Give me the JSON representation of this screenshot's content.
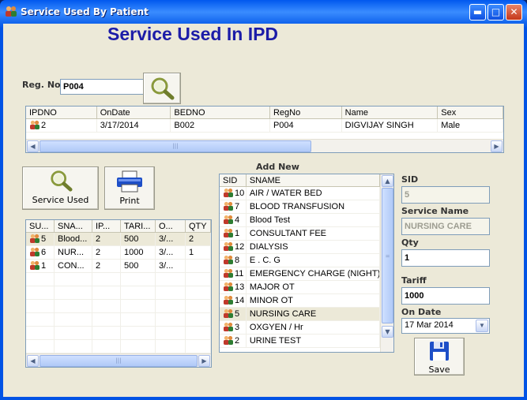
{
  "window": {
    "title": "Service Used By Patient"
  },
  "heading": "Service Used In IPD",
  "reg": {
    "label": "Reg. No.",
    "value": "P004"
  },
  "ipd_grid": {
    "columns": [
      "IPDNO",
      "OnDate",
      "BEDNO",
      "RegNo",
      "Name",
      "Sex"
    ],
    "rows": [
      [
        "2",
        "3/17/2014",
        "B002",
        "P004",
        "DIGVIJAY SINGH",
        "Male"
      ]
    ]
  },
  "buttons": {
    "service_used": "Service Used",
    "print": "Print",
    "save": "Save"
  },
  "used_grid": {
    "columns": [
      "SU...",
      "SNA...",
      "IP...",
      "TARI...",
      "O...",
      "QTY"
    ],
    "rows": [
      [
        "5",
        "Blood...",
        "2",
        "500",
        "3/...",
        "2"
      ],
      [
        "6",
        "NUR...",
        "2",
        "1000",
        "3/...",
        "1"
      ],
      [
        "1",
        "CON...",
        "2",
        "500",
        "3/...",
        ""
      ]
    ]
  },
  "add_new": {
    "title": "Add New",
    "columns": [
      "SID",
      "SNAME"
    ],
    "rows": [
      [
        "10",
        "AIR / WATER BED"
      ],
      [
        "7",
        "BLOOD TRANSFUSION"
      ],
      [
        "4",
        "Blood Test"
      ],
      [
        "1",
        "CONSULTANT FEE"
      ],
      [
        "12",
        "DIALYSIS"
      ],
      [
        "8",
        "E . C. G"
      ],
      [
        "11",
        "EMERGENCY CHARGE (NIGHT)"
      ],
      [
        "13",
        "MAJOR OT"
      ],
      [
        "14",
        "MINOR OT"
      ],
      [
        "5",
        "NURSING CARE"
      ],
      [
        "3",
        "OXGYEN / Hr"
      ],
      [
        "2",
        "URINE TEST"
      ]
    ],
    "selected_index": 9
  },
  "form": {
    "sid_label": "SID",
    "sid_value": "5",
    "service_label": "Service Name",
    "service_value": "NURSING CARE",
    "qty_label": "Qty",
    "qty_value": "1",
    "tariff_label": "Tariff",
    "tariff_value": "1000",
    "ondate_label": "On Date",
    "ondate_value": "17 Mar 2014"
  },
  "icons": {
    "window": "patients-icon",
    "search": "magnifier-icon",
    "print": "printer-icon",
    "save": "floppy-disk-icon",
    "row": "patient-icon"
  }
}
